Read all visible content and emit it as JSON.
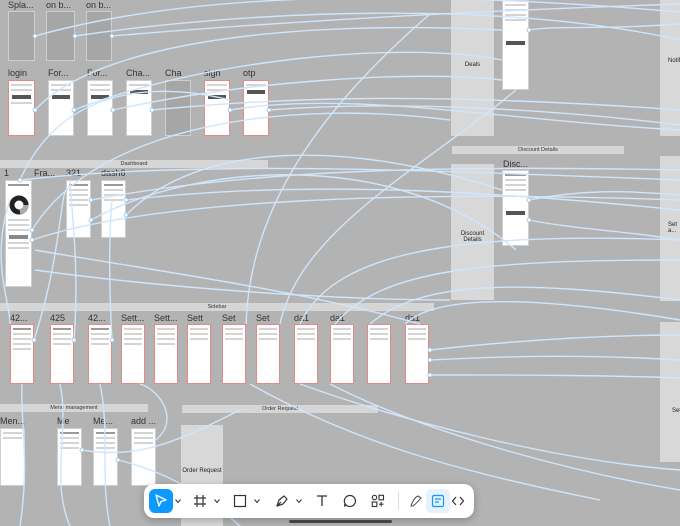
{
  "frames": {
    "splash": "Spla...",
    "onb1": "on b...",
    "onb2": "on b...",
    "login": "login",
    "forgot1": "For...",
    "forgot2": "For...",
    "change": "Cha...",
    "cha2": "Cha",
    "sign": "sign",
    "otp": "otp",
    "d1": "1",
    "fra": "Fra...",
    "n321": "321",
    "dash6": "dash6",
    "n42a": "42...",
    "n425": "425",
    "n42b": "42...",
    "sett1": "Sett...",
    "sett2": "Sett...",
    "sett3": "Sett",
    "set4": "Set",
    "set5": "Set",
    "da1": "da1",
    "da2": "da1",
    "da3": "da1",
    "men1": "Men...",
    "men2": "Me",
    "men3": "Me...",
    "add": "add ...",
    "disc": "Disc..."
  },
  "sections": {
    "dashboard": "Dashboard",
    "discount": "Discount Details",
    "sidebar": "Sidebar",
    "menu": "Menu management",
    "order": "Order Request"
  },
  "panels": {
    "deals": "Deals",
    "discount": "Discount Details",
    "order": "Order Request",
    "right1": "Notifi...",
    "right2": "Set a...",
    "right3": "Set..."
  },
  "toolbar": {
    "tools": [
      "move",
      "frame",
      "rectangle",
      "pen",
      "text",
      "comment",
      "actions",
      "draw",
      "design",
      "dev-mode"
    ]
  },
  "colors": {
    "canvas": "#b3b3b3",
    "wire": "#cfe6fb",
    "accent": "#0d99ff"
  }
}
